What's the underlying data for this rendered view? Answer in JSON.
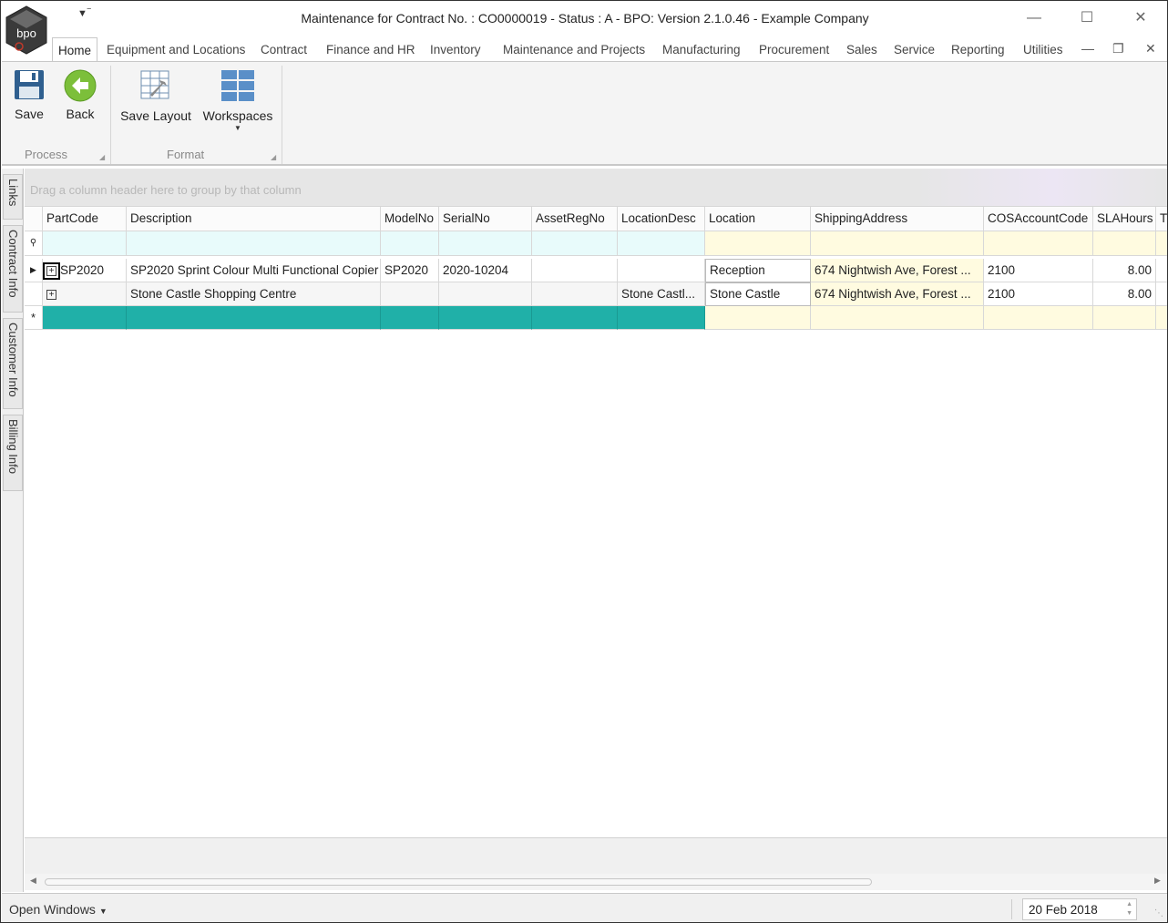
{
  "window": {
    "title": "Maintenance for Contract No. : CO0000019 - Status : A - BPO: Version 2.1.0.46 - Example Company",
    "logo_text": "bpo",
    "controls": [
      "minimize-icon",
      "maximize-icon",
      "close-icon"
    ]
  },
  "ribbon": {
    "tabs": [
      "Home",
      "Equipment and Locations",
      "Contract",
      "Finance and HR",
      "Inventory",
      "Maintenance and Projects",
      "Manufacturing",
      "Procurement",
      "Sales",
      "Service",
      "Reporting",
      "Utilities"
    ],
    "active_tab": "Home",
    "buttons": {
      "save": "Save",
      "back": "Back",
      "save_layout": "Save Layout",
      "workspaces": "Workspaces"
    },
    "groups": {
      "process": "Process",
      "format": "Format"
    }
  },
  "side_tabs": [
    "Links",
    "Contract Info",
    "Customer Info",
    "Billing Info"
  ],
  "grid": {
    "group_panel_hint": "Drag a column header here to group by that column",
    "columns": [
      "PartCode",
      "Description",
      "ModelNo",
      "SerialNo",
      "AssetRegNo",
      "LocationDesc",
      "Location",
      "ShippingAddress",
      "COSAccountCode",
      "SLAHours",
      "T"
    ],
    "rows": [
      {
        "PartCode": "SP2020",
        "Description": "SP2020 Sprint Colour Multi Functional Copier",
        "ModelNo": "SP2020",
        "SerialNo": "2020-10204",
        "AssetRegNo": "",
        "LocationDesc": "",
        "Location": "Reception",
        "ShippingAddress": "674 Nightwish Ave, Forest ...",
        "COSAccountCode": "2100",
        "SLAHours": "8.00"
      },
      {
        "PartCode": "",
        "Description": "Stone Castle Shopping Centre",
        "ModelNo": "",
        "SerialNo": "",
        "AssetRegNo": "",
        "LocationDesc": "Stone Castl...",
        "Location": "Stone Castle",
        "ShippingAddress": "674 Nightwish Ave, Forest ...",
        "COSAccountCode": "2100",
        "SLAHours": "8.00"
      }
    ],
    "new_row_indicator": "*",
    "filter_indicator": "filter-icon"
  },
  "statusbar": {
    "open_windows": "Open Windows",
    "date": "20 Feb 2018"
  }
}
